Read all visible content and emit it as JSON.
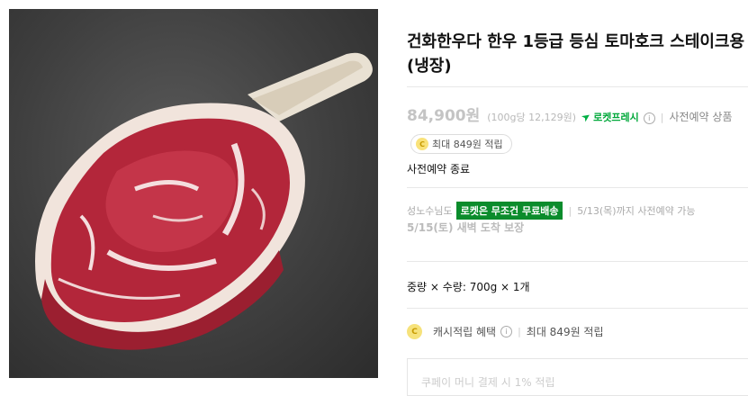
{
  "product": {
    "title": "건화한우다 한우 1등급 등심 토마호크 스테이크용 (냉장)",
    "image_alt": "tomahawk-steak"
  },
  "price": {
    "amount": "84,900원",
    "unit_price": "(100g당 12,129원)",
    "rocket_label": "로켓프레시",
    "preorder_label": "사전예약 상품"
  },
  "reward": {
    "label": "최대 849원 적립"
  },
  "preorder_status": "사전예약 종료",
  "shipping": {
    "region": "성노수님도",
    "free_badge": "로켓은 무조건 무료배송",
    "preorder_date": "5/13(목)까지 사전예약 가능",
    "arrival": "5/15(토) 새벽 도착 보장"
  },
  "option": {
    "text": "중량 × 수량: 700g × 1개"
  },
  "cash_benefit": {
    "label": "캐시적립 혜택",
    "detail": "최대 849원 적립",
    "box_text": "쿠페이 머니 결제 시 1% 적립"
  },
  "colors": {
    "rocket_green": "#00a83a",
    "badge_green": "#0b8c2c",
    "coin_yellow": "#f9e27a"
  }
}
